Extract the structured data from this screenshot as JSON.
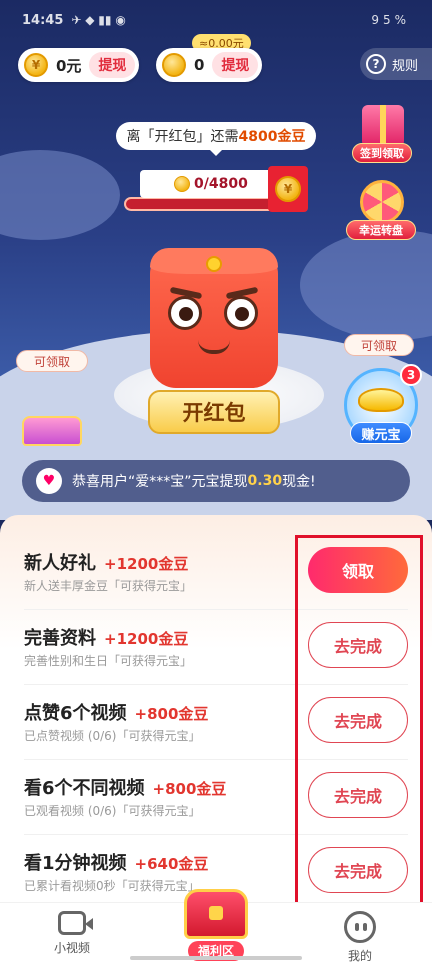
{
  "status_bar": {
    "time": "14:45",
    "battery": "95%",
    "icons": "✈ ◆ ▮▮ ◉"
  },
  "wallet": {
    "cash_value": "0元",
    "withdraw_label": "提现",
    "coin_value": "0",
    "coin_withdraw_label": "提现",
    "approx_label": "≈0.00元"
  },
  "rules_label": "规则",
  "tip": {
    "prefix": "离「开红包」还需",
    "amount": "4800金豆"
  },
  "progress": {
    "text": "0/4800",
    "current": 0,
    "target": 4800
  },
  "side_buttons": {
    "sign_in": "签到领取",
    "lucky_wheel": "幸运转盘"
  },
  "open_button": "开红包",
  "chest_tag": "可领取",
  "ingot": {
    "tag": "可领取",
    "label": "赚元宝",
    "badge": "3"
  },
  "notice": {
    "text_prefix": "恭喜用户“爱***宝”元宝提现",
    "amount": "0.30",
    "text_suffix": "现金!"
  },
  "tasks": [
    {
      "title": "新人好礼",
      "reward": "+1200金豆",
      "desc": "新人送丰厚金豆「可获得元宝」",
      "button": "领取",
      "primary": true
    },
    {
      "title": "完善资料",
      "reward": "+1200金豆",
      "desc": "完善性别和生日「可获得元宝」",
      "button": "去完成",
      "primary": false
    },
    {
      "title": "点赞6个视频",
      "reward": "+800金豆",
      "desc": "已点赞视频 (0/6)「可获得元宝」",
      "button": "去完成",
      "primary": false
    },
    {
      "title": "看6个不同视频",
      "reward": "+800金豆",
      "desc": "已观看视频 (0/6)「可获得元宝」",
      "button": "去完成",
      "primary": false
    },
    {
      "title": "看1分钟视频",
      "reward": "+640金豆",
      "desc": "已累计看视频0秒「可获得元宝」",
      "button": "去完成",
      "primary": false
    }
  ],
  "nav": {
    "video": "小视频",
    "welfare": "福利区",
    "mine": "我的"
  },
  "colors": {
    "accent": "#e04653",
    "reward": "#e2362f",
    "highlight": "#e0102a"
  }
}
